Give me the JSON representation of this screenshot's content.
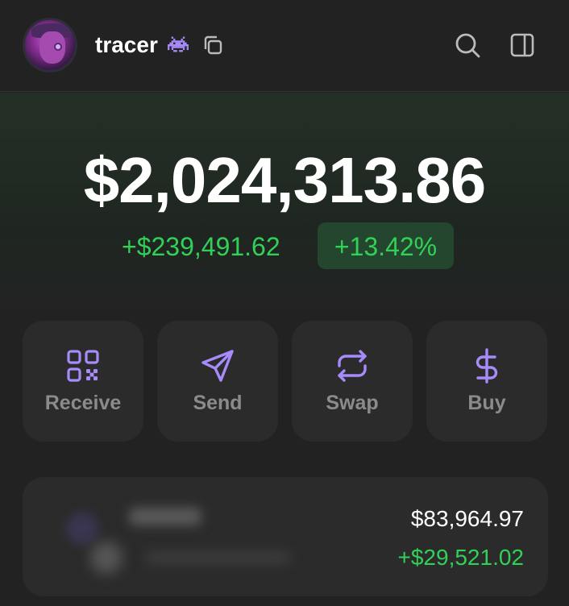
{
  "header": {
    "username": "tracer",
    "badge_icon": "alien-icon",
    "copy_icon": "copy-icon",
    "search_icon": "search-icon",
    "sidebar_icon": "sidebar-toggle-icon"
  },
  "portfolio": {
    "balance": "$2,024,313.86",
    "change_amount": "+$239,491.62",
    "change_percent": "+13.42%"
  },
  "actions": [
    {
      "label": "Receive",
      "icon": "qr-code-icon"
    },
    {
      "label": "Send",
      "icon": "send-icon"
    },
    {
      "label": "Swap",
      "icon": "swap-icon"
    },
    {
      "label": "Buy",
      "icon": "dollar-icon"
    }
  ],
  "tokens": [
    {
      "value": "$83,964.97",
      "change": "+$29,521.02"
    }
  ],
  "colors": {
    "accent": "#a78bfa",
    "positive": "#31d158",
    "background": "#222222",
    "card": "#2b2b2b"
  }
}
